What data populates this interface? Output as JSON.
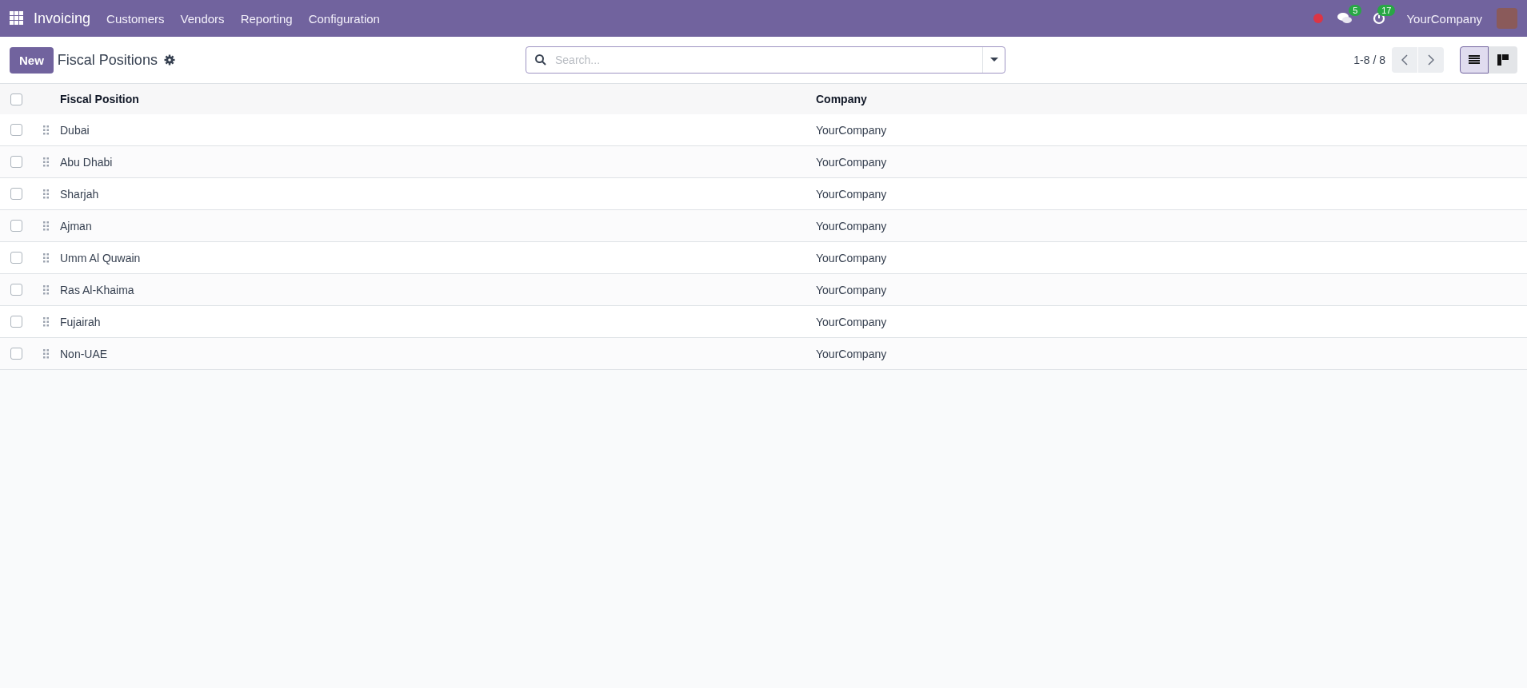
{
  "navbar": {
    "app_name": "Invoicing",
    "menu": [
      "Customers",
      "Vendors",
      "Reporting",
      "Configuration"
    ],
    "messages_badge": "5",
    "activities_badge": "17",
    "company": "YourCompany"
  },
  "control_panel": {
    "new_button": "New",
    "title": "Fiscal Positions",
    "search": {
      "placeholder": "Search..."
    },
    "pager": "1-8 / 8",
    "views": [
      {
        "kind": "list",
        "selected": true
      },
      {
        "kind": "kanban",
        "selected": false
      }
    ]
  },
  "table": {
    "select_all": {
      "checked": false
    },
    "columns": [
      "Fiscal Position",
      "Company"
    ],
    "rows": [
      {
        "checked": false,
        "cells": [
          "Dubai",
          "YourCompany"
        ]
      },
      {
        "checked": false,
        "cells": [
          "Abu Dhabi",
          "YourCompany"
        ]
      },
      {
        "checked": false,
        "cells": [
          "Sharjah",
          "YourCompany"
        ]
      },
      {
        "checked": false,
        "cells": [
          "Ajman",
          "YourCompany"
        ]
      },
      {
        "checked": false,
        "cells": [
          "Umm Al Quwain",
          "YourCompany"
        ]
      },
      {
        "checked": false,
        "cells": [
          "Ras Al-Khaima",
          "YourCompany"
        ]
      },
      {
        "checked": false,
        "cells": [
          "Fujairah",
          "YourCompany"
        ]
      },
      {
        "checked": false,
        "cells": [
          "Non-UAE",
          "YourCompany"
        ]
      }
    ]
  }
}
